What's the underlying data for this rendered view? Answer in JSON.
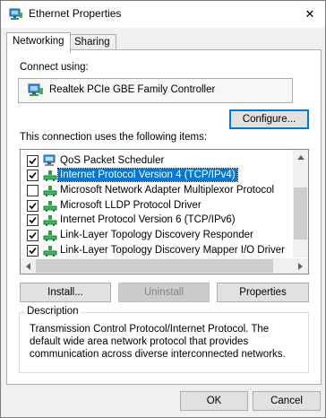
{
  "window": {
    "title": "Ethernet Properties",
    "close_glyph": "✕"
  },
  "tabs": [
    {
      "label": "Networking",
      "active": true
    },
    {
      "label": "Sharing",
      "active": false
    }
  ],
  "connect_using": {
    "label": "Connect using:",
    "adapter": "Realtek PCIe GBE Family Controller",
    "icon": "network-adapter-icon"
  },
  "configure_button": "Configure...",
  "items_label": "This connection uses the following items:",
  "items": [
    {
      "label": "QoS Packet Scheduler",
      "checked": true,
      "icon": "service-icon"
    },
    {
      "label": "Internet Protocol Version 4 (TCP/IPv4)",
      "checked": true,
      "icon": "protocol-icon",
      "selected": true
    },
    {
      "label": "Microsoft Network Adapter Multiplexor Protocol",
      "checked": false,
      "icon": "protocol-icon"
    },
    {
      "label": "Microsoft LLDP Protocol Driver",
      "checked": true,
      "icon": "protocol-icon"
    },
    {
      "label": "Internet Protocol Version 6 (TCP/IPv6)",
      "checked": true,
      "icon": "protocol-icon"
    },
    {
      "label": "Link-Layer Topology Discovery Responder",
      "checked": true,
      "icon": "protocol-icon"
    },
    {
      "label": "Link-Layer Topology Discovery Mapper I/O Driver",
      "checked": true,
      "icon": "protocol-icon"
    }
  ],
  "buttons": {
    "install": "Install...",
    "uninstall": "Uninstall",
    "properties": "Properties"
  },
  "description": {
    "title": "Description",
    "text": "Transmission Control Protocol/Internet Protocol. The default wide area network protocol that provides communication across diverse interconnected networks."
  },
  "footer": {
    "ok": "OK",
    "cancel": "Cancel"
  },
  "colors": {
    "selection": "#0078d7",
    "window_bg": "#f0f0f0",
    "accent_border": "#0078d7"
  }
}
